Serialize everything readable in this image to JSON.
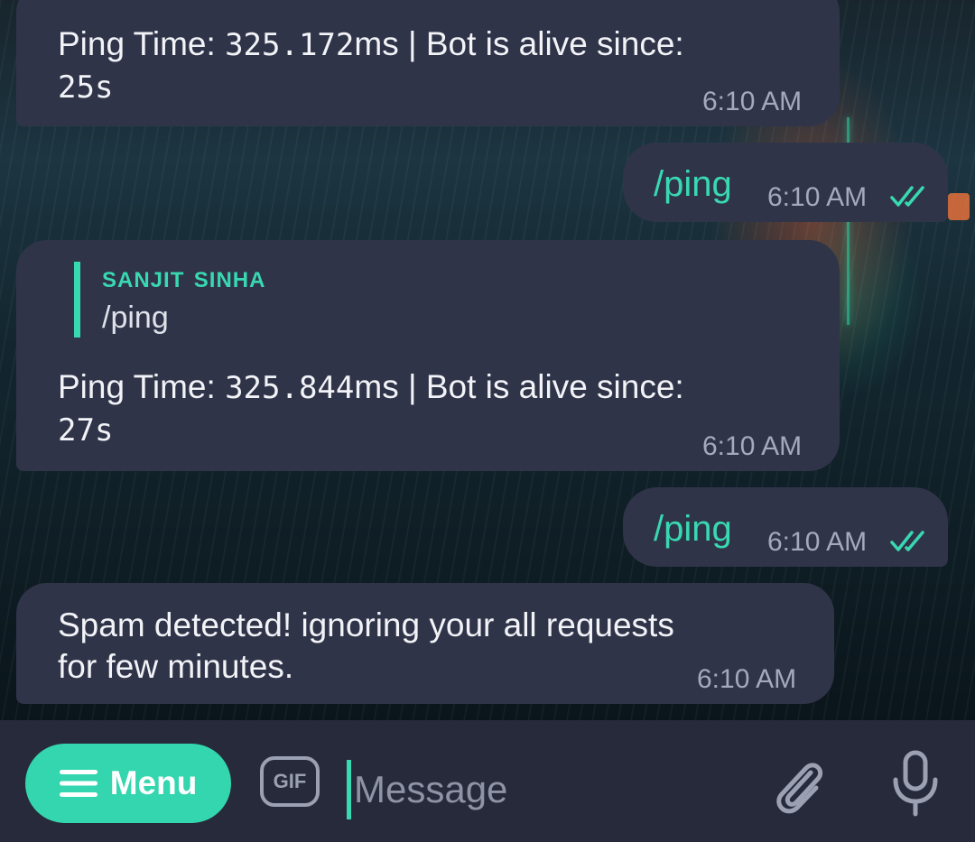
{
  "colors": {
    "bubble_incoming": "#303449",
    "bubble_outgoing": "#303449",
    "accent": "#38d8b1",
    "composer_bg": "#272a3a",
    "menu_button": "#33d6ae",
    "timestamp": "#a4a9bb"
  },
  "messages": [
    {
      "direction": "incoming",
      "text_prefix": "Ping Time: ",
      "ping_value": "325.172",
      "text_suffix": "ms | Bot is alive since:",
      "uptime": "25s",
      "time": "6:10 AM"
    },
    {
      "direction": "outgoing",
      "text": "/ping",
      "time": "6:10 AM",
      "status_icon": "double-check-icon"
    },
    {
      "direction": "incoming",
      "reply_to": {
        "name": "sanjit sinha",
        "text": "/ping"
      },
      "text_prefix": "Ping Time: ",
      "ping_value": "325.844",
      "text_suffix": "ms | Bot is alive since:",
      "uptime": "27s",
      "time": "6:10 AM"
    },
    {
      "direction": "outgoing",
      "text": "/ping",
      "time": "6:10 AM",
      "status_icon": "double-check-icon"
    },
    {
      "direction": "incoming",
      "line1": "Spam detected! ignoring your all requests",
      "line2": "for few minutes.",
      "time": "6:10 AM"
    }
  ],
  "composer": {
    "menu_label": "Menu",
    "menu_icon": "hamburger-icon",
    "gif_label": "GIF",
    "placeholder": "Message",
    "attach_icon": "paperclip-icon",
    "voice_icon": "microphone-icon"
  }
}
